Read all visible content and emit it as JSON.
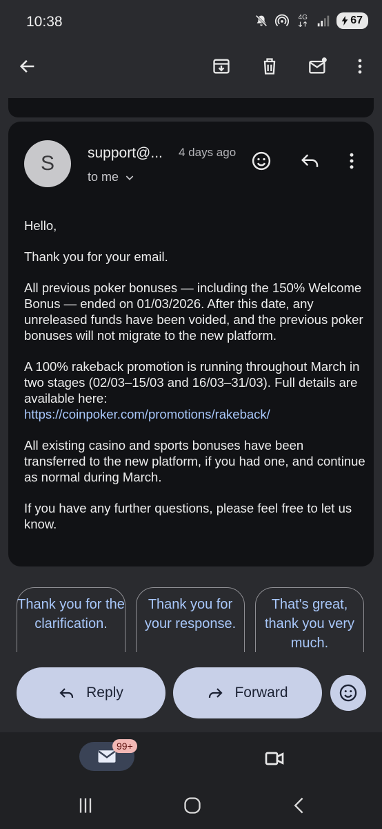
{
  "status_bar": {
    "time": "10:38",
    "network_label": "4G",
    "battery": "67",
    "icons": [
      "mute-icon",
      "hotspot-icon",
      "network-4g-icon",
      "signal-icon",
      "battery-charging-icon"
    ]
  },
  "toolbar": {
    "icons": [
      "back-arrow-icon",
      "archive-icon",
      "delete-icon",
      "mark-unread-icon",
      "more-vert-icon"
    ]
  },
  "message": {
    "avatar_initial": "S",
    "sender": "support@...",
    "time": "4 days ago",
    "recipient": "to me",
    "body": {
      "greeting": "Hello,",
      "p1": "Thank you for your email.",
      "p2": "All previous poker bonuses — including the 150% Welcome Bonus — ended on 01/03/2026. After this date, any unreleased funds have been voided, and the previous poker bonuses will not migrate to the new platform.",
      "p3_text": "A 100% rakeback promotion is running throughout March in two stages (02/03–15/03 and 16/03–31/03). Full details are available here:",
      "p3_link": "https://coinpoker.com/promotions/rakeback/",
      "p4": "All existing casino and sports bonuses have been transferred to the new platform, if you had one, and continue as normal during March.",
      "p5": "If you have any further questions, please feel free to let us know."
    }
  },
  "smart_replies": [
    "Thank you for the clarification.",
    "Thank you for your response.",
    "That's great, thank you very much."
  ],
  "actions": {
    "reply": "Reply",
    "forward": "Forward"
  },
  "bottom_nav": {
    "mail_badge": "99+"
  },
  "colors": {
    "background": "#2a2b2f",
    "card": "#111215",
    "link": "#a8c7fa",
    "pill": "#c8d0e8",
    "badge": "#f2b8b5"
  }
}
